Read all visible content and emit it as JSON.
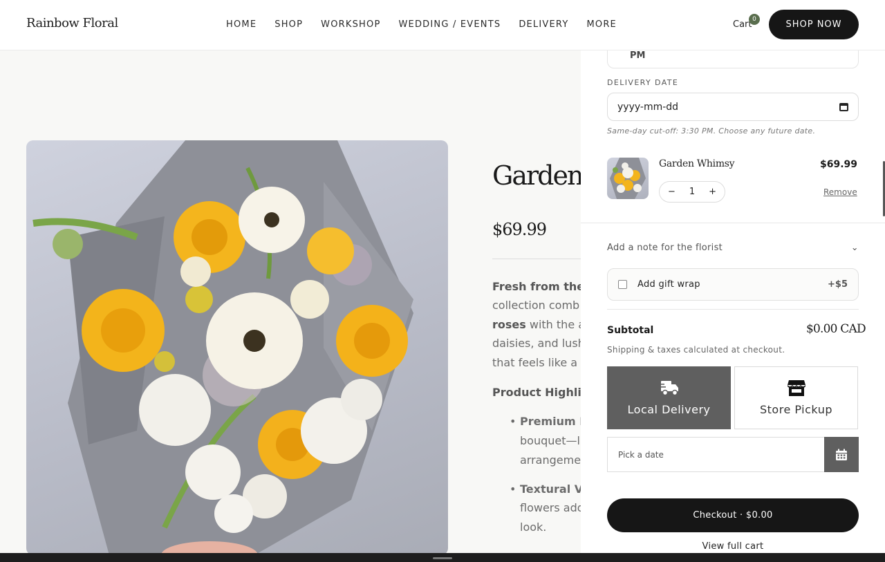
{
  "header": {
    "brand": "Rainbow Floral",
    "nav": [
      "HOME",
      "SHOP",
      "WORKSHOP",
      "WEDDING / EVENTS",
      "DELIVERY",
      "MORE"
    ],
    "cart_label": "Cart",
    "cart_count": "0",
    "cta": "SHOP NOW"
  },
  "product": {
    "title": "Garden W",
    "price": "$69.99",
    "desc": {
      "line1_bold": "Fresh from the",
      "line2": "collection comb",
      "line3_bold": "roses",
      "line3_rest": " with the a",
      "line4": "daisies, and lush",
      "line5": "that feels like a"
    },
    "highlights_heading": "Product Highligh",
    "bullets": [
      {
        "bold": "Premium E",
        "line2": "bouquet—l",
        "line3": "arrangeme"
      },
      {
        "bold": "Textural Va",
        "line2": "flowers add",
        "line3": "look."
      }
    ]
  },
  "drawer": {
    "pm_label": "PM",
    "delivery_date_label": "DELIVERY DATE",
    "delivery_date_value": "yyyy-mm-dd",
    "delivery_hint": "Same-day cut-off: 3:30 PM. Choose any future date.",
    "item": {
      "name": "Garden Whimsy",
      "price": "$69.99",
      "qty": "1",
      "minus": "−",
      "plus": "+",
      "remove": "Remove"
    },
    "note_label": "Add a note for the florist",
    "gift_label": "Add gift wrap",
    "gift_price": "+$5",
    "subtotal_label": "Subtotal",
    "subtotal_value": "$0.00 CAD",
    "shipping_note": "Shipping & taxes calculated at checkout.",
    "options": {
      "delivery": "Local Delivery",
      "pickup": "Store Pickup"
    },
    "date_placeholder": "Pick a date",
    "checkout": "Checkout · $0.00",
    "view_cart": "View full cart"
  },
  "icons": {
    "delivery": "truck-icon",
    "pickup": "store-icon",
    "calendar": "calendar-icon",
    "chevron": "chevron-down-icon"
  },
  "colors": {
    "primary_dark": "#161616",
    "badge": "#5a6e4e",
    "selected_option": "#5f5f5f"
  }
}
